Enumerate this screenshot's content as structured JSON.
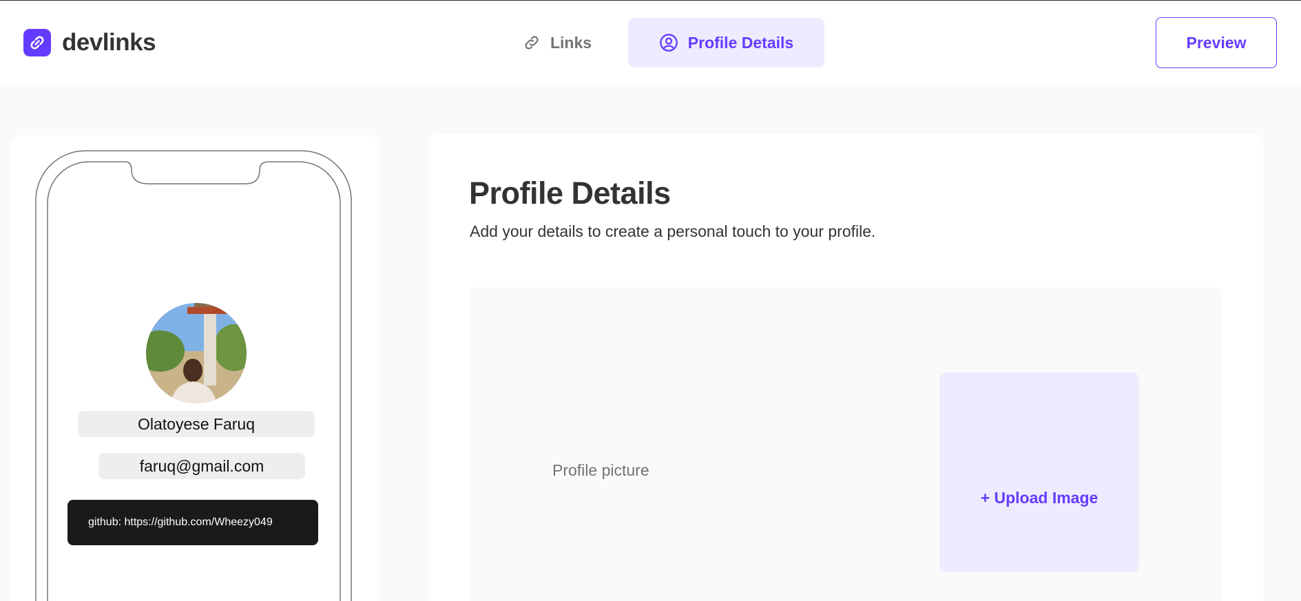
{
  "app": {
    "name": "devlinks"
  },
  "header": {
    "tabs": [
      {
        "label": "Links",
        "icon": "link-icon",
        "active": false
      },
      {
        "label": "Profile Details",
        "icon": "user-circle-icon",
        "active": true
      }
    ],
    "preview_label": "Preview"
  },
  "phone_preview": {
    "name": "Olatoyese Faruq",
    "email": "faruq@gmail.com",
    "links": [
      {
        "label": "github: https://github.com/Wheezy049"
      }
    ]
  },
  "main": {
    "title": "Profile Details",
    "subtitle": "Add your details to create a personal touch to your profile.",
    "picture_label": "Profile picture",
    "upload_label": "+ Upload Image"
  },
  "colors": {
    "accent": "#633cff",
    "accent_light": "#efebff",
    "text_dark": "#333333",
    "text_grey": "#737373",
    "background": "#fafafa"
  }
}
